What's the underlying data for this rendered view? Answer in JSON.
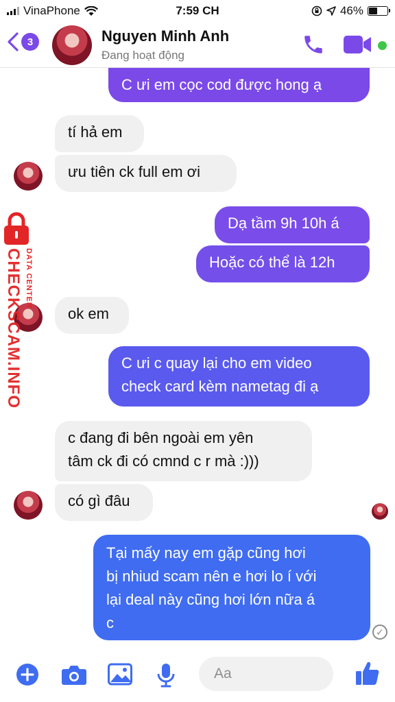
{
  "status_bar": {
    "carrier": "VinaPhone",
    "time": "7:59 CH",
    "battery": "46%",
    "battery_level": 0.46
  },
  "header": {
    "unread_count": "3",
    "contact_name": "Nguyen Minh Anh",
    "contact_status": "Đang hoạt động",
    "icons": [
      "back-chevron",
      "phone",
      "video-camera",
      "online-dot"
    ]
  },
  "messages": [
    {
      "from": "me",
      "text": "C ưi em cọc cod được hong ạ"
    },
    {
      "from": "them",
      "text": "tí hả em"
    },
    {
      "from": "them",
      "text": "ưu tiên ck full em ơi"
    },
    {
      "from": "me",
      "text": "Dạ tầm 9h 10h á"
    },
    {
      "from": "me",
      "text": "Hoặc có thể là 12h"
    },
    {
      "from": "them",
      "text": "ok em"
    },
    {
      "from": "me",
      "lines": [
        "C ưi c quay lại cho em video",
        "check card kèm nametag đi ạ"
      ]
    },
    {
      "from": "them",
      "lines": [
        "c đang đi bên ngoài em yên",
        "tâm ck đi có cmnd c r mà :)))"
      ]
    },
    {
      "from": "them",
      "text": "có gì đâu"
    },
    {
      "from": "me",
      "lines": [
        "Tại mấy nay em gặp cũng hơi",
        "bị nhiud scam nên e hơi lo í với",
        "lại deal này cũng hơi lớn nữa á",
        "c"
      ]
    }
  ],
  "watermark": {
    "main": "CHECKSCAM.INFO",
    "small": "DATA CENTER"
  },
  "composer": {
    "placeholder": "Aa",
    "icons": [
      "plus",
      "camera",
      "gallery",
      "microphone",
      "emoji",
      "thumbs-up"
    ]
  },
  "colors": {
    "accent": "#7b49e8",
    "outgoing_purple": "#7b49e8",
    "outgoing_blue": "#3f6cf0",
    "incoming": "#f0f0f0",
    "online": "#3ec64a",
    "watermark": "#e22526"
  }
}
